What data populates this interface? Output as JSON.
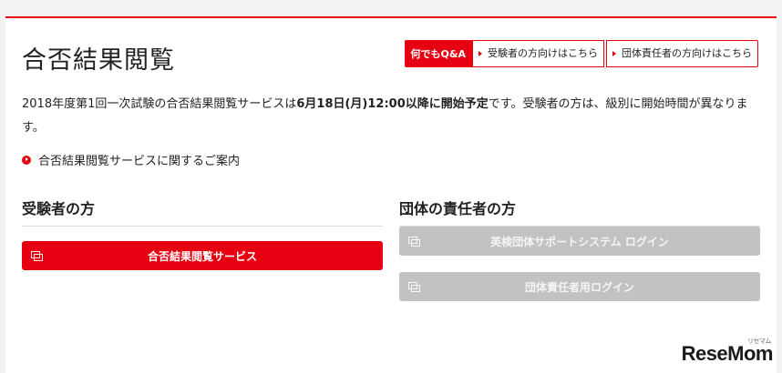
{
  "header": {
    "title": "合否結果閲覧",
    "nav": {
      "qa_label": "何でもQ&A",
      "examinee_link": "受験者の方向けはこちら",
      "group_link": "団体責任者の方向けはこちら"
    }
  },
  "notice": {
    "part1": "2018年度第1回一次試験の合否結果閲覧サービスは",
    "bold": "6月18日(月)12:00以降に開始予定",
    "part2": "です。受験者の方は、級別に開始時間が異なります。"
  },
  "info_link": "合否結果閲覧サービスに関するご案内",
  "sections": {
    "examinee": {
      "heading": "受験者の方",
      "button": "合否結果閲覧サービス"
    },
    "group": {
      "heading": "団体の責任者の方",
      "button1": "英検団体サポートシステム ログイン",
      "button2": "団体責任者用ログイン"
    }
  },
  "watermark": {
    "text": "ReseMom",
    "sub": "リセマム"
  },
  "colors": {
    "accent": "#e60012",
    "disabled": "#c2c2c2"
  }
}
